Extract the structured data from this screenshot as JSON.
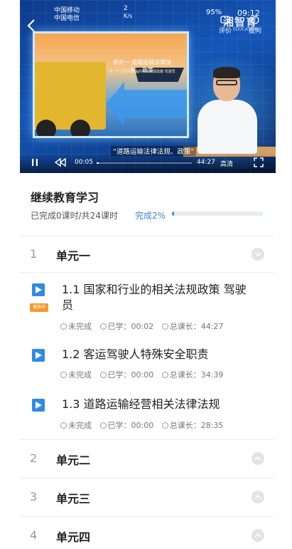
{
  "status_bar": {
    "carrier_1": "中国移动",
    "carrier_2": "中国电信",
    "net_speed": "2",
    "net_unit": "K/s",
    "battery": "95%",
    "time": "09:12"
  },
  "video": {
    "brand_text": "湘智育",
    "brand_sub": "EDUCATION",
    "rate_label": "评价",
    "ask_label": "提问",
    "slide_title": "单元一 道路运输法律法规、政策",
    "slide_subtitle": "第一节 国家和行业的相关法规政策 驾驶员",
    "caption": "“道路运输法律法规、政策”",
    "current_time": "00:05",
    "total_time": "44:27",
    "quality": "高清",
    "progress": 0.02
  },
  "course": {
    "title": "继续教育学习",
    "stats": "已完成0课时/共24课时",
    "percent_label": "完成2%",
    "progress": 0.02
  },
  "units": [
    {
      "num": "1",
      "name": "单元一",
      "expanded": true,
      "lessons": [
        {
          "title_line1": "1.1 国家和行业的相关法规政策 驾驶",
          "title_line2": "员",
          "badge": "播放中",
          "status": "未完成",
          "learned": "已学：00:02",
          "duration": "总课长：44:27"
        },
        {
          "title_line1": "1.2 客运驾驶人特殊安全职责",
          "status": "未完成",
          "learned": "已学：00:00",
          "duration": "总课长：34:39"
        },
        {
          "title_line1": "1.3 道路运输经营相关法律法规",
          "status": "未完成",
          "learned": "已学：00:00",
          "duration": "总课长：28:35"
        }
      ]
    },
    {
      "num": "2",
      "name": "单元二",
      "expanded": false
    },
    {
      "num": "3",
      "name": "单元三",
      "expanded": false
    },
    {
      "num": "4",
      "name": "单元四",
      "expanded": false
    }
  ],
  "colors": {
    "accent": "#3a86d6",
    "lesson_icon": "#2f8be8",
    "playing_badge": "#f19a2b"
  }
}
